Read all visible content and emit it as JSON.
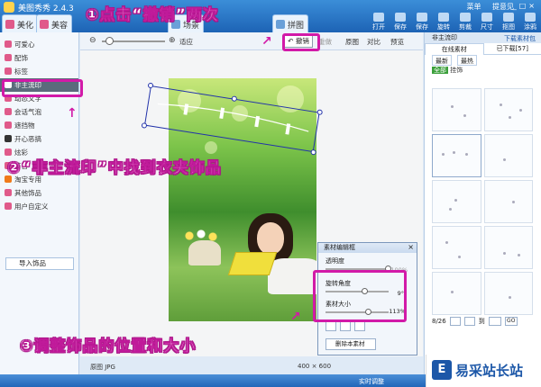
{
  "app": {
    "title": "美图秀秀 2.4.3"
  },
  "main_tabs": [
    {
      "label": "美化",
      "color": "#e05a8a"
    },
    {
      "label": "美容",
      "color": "#e05a8a"
    },
    {
      "label": "场景",
      "color": "#6aa0d8"
    },
    {
      "label": "拼图",
      "color": "#6aa0d8"
    }
  ],
  "top_menu": {
    "menu": "菜单",
    "feedback": "提意见"
  },
  "toolbar_top": [
    "打开",
    "保存",
    "保存",
    "旋转",
    "剪裁",
    "尺寸",
    "抠图",
    "涂鸦",
    "背景"
  ],
  "sidebar": {
    "items": [
      {
        "label": "可爱心"
      },
      {
        "label": "配饰"
      },
      {
        "label": "标签"
      },
      {
        "label": "非主流印",
        "active": true
      },
      {
        "label": "动态文字"
      },
      {
        "label": "会话气泡"
      },
      {
        "label": "遮挡物"
      },
      {
        "label": "开心恶搞"
      },
      {
        "label": "炫彩"
      },
      {
        "label": "节日"
      },
      {
        "label": "淘宝专用"
      },
      {
        "label": "其他饰品"
      },
      {
        "label": "用户自定义"
      }
    ],
    "import_label": "导入饰品"
  },
  "editor_toolbar": {
    "fit_label": "适应",
    "undo_label": "撤销",
    "redo_label": "重做",
    "original_label": "原图",
    "compare_label": "对比",
    "preview_label": "预览"
  },
  "canvas": {
    "original_label": "原图 JPG",
    "size_label": "400 × 600"
  },
  "material_editor": {
    "title": "素材编辑框",
    "opacity_label": "透明度",
    "opacity_value": "100%",
    "rotate_label": "旋转角度",
    "rotate_value": "9°",
    "size_label": "素材大小",
    "size_value": "113%",
    "delete_label": "删除本素材"
  },
  "right_panel": {
    "header": "非主流印",
    "tabs": [
      "在线素材",
      "已下载[57]"
    ],
    "download_pack": "下载素材包",
    "sub_tabs": [
      "最新",
      "最热"
    ],
    "category_tag": "全部",
    "category_label": "挂饰",
    "pager": {
      "page": "8/26",
      "goto_prefix": "到",
      "go_label": "GO"
    }
  },
  "status": {
    "notice": "实时调整"
  },
  "annotations": {
    "step1": "①点击“撤销”两次",
    "step2": "②“非主流印”中找到衣夹饰品",
    "step3": "③调整饰品的位置和大小"
  },
  "watermark": {
    "logo": "E",
    "text": "易采站长站"
  }
}
